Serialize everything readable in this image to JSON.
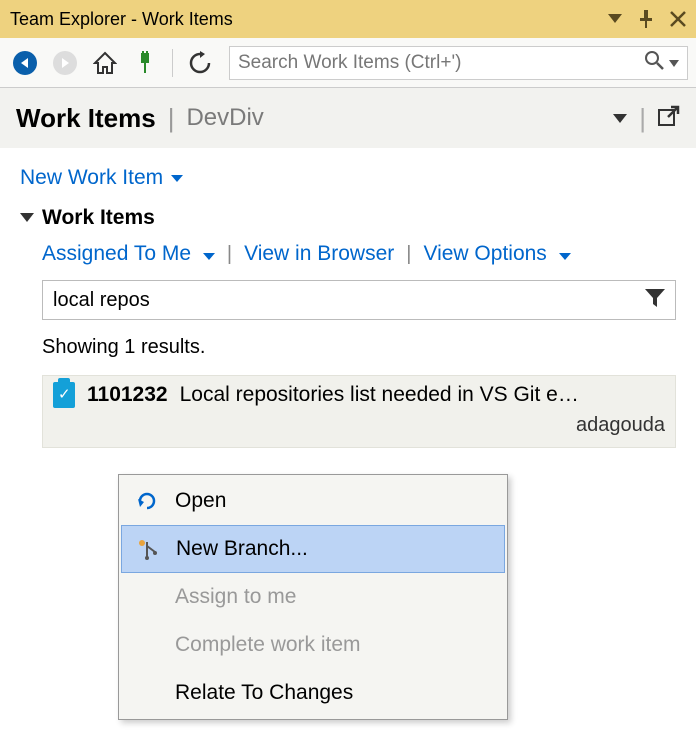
{
  "titlebar": {
    "title": "Team Explorer - Work Items"
  },
  "search": {
    "placeholder": "Search Work Items (Ctrl+')"
  },
  "header": {
    "title": "Work Items",
    "project": "DevDiv"
  },
  "actions": {
    "new_work_item": "New Work Item"
  },
  "section": {
    "title": "Work Items",
    "filter": "Assigned To Me",
    "view_browser": "View in Browser",
    "view_options": "View Options",
    "search_value": "local repos",
    "results_text": "Showing 1 results."
  },
  "result": {
    "id": "1101232",
    "title": "Local repositories list needed in VS Git e…",
    "assignee_fragment": "adagouda"
  },
  "context_menu": {
    "open": "Open",
    "new_branch": "New Branch...",
    "assign": "Assign to me",
    "complete": "Complete work item",
    "relate": "Relate To Changes"
  }
}
